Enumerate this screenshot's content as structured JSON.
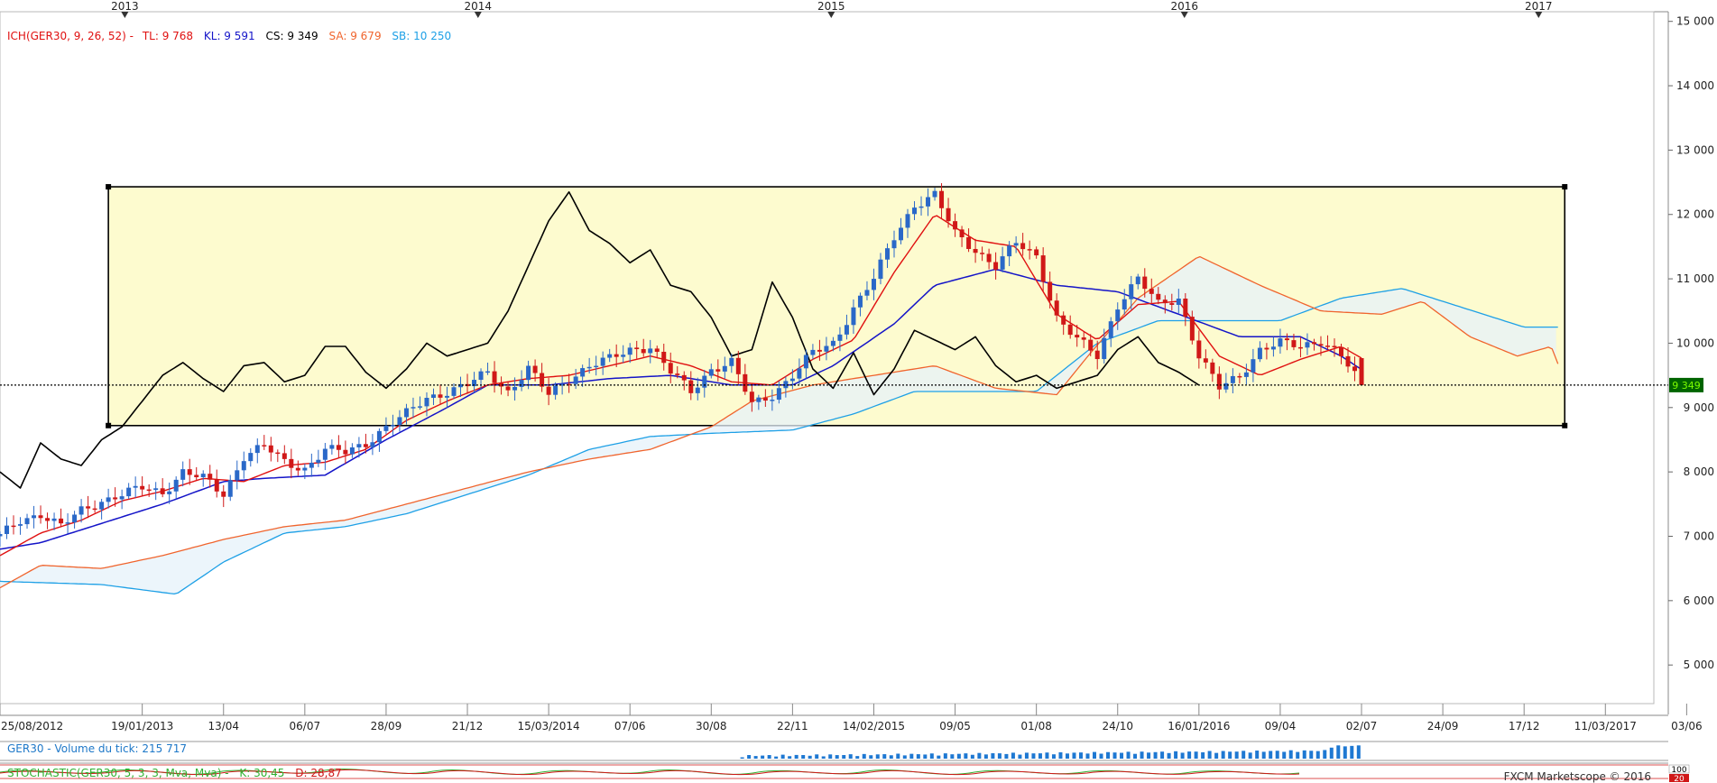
{
  "chart_data": {
    "type": "line",
    "instrument": "GER30",
    "last_price_label": "9 349",
    "y_axis": {
      "ylim": [
        4400,
        15150
      ],
      "tick_labels": [
        "15 000",
        "14 000",
        "13 000",
        "12 000",
        "11 000",
        "10 000",
        "9 000",
        "8 000",
        "7 000",
        "6 000",
        "5 000"
      ],
      "tick_values": [
        15000,
        14000,
        13000,
        12000,
        11000,
        10000,
        9000,
        8000,
        7000,
        6000,
        5000
      ]
    },
    "x_axis": {
      "range": [
        "2012-08-25",
        "2017-05-15"
      ],
      "tick_labels": [
        "25/08/2012",
        "19/01/2013",
        "13/04",
        "06/07",
        "28/09",
        "21/12",
        "15/03/2014",
        "07/06",
        "30/08",
        "22/11",
        "14/02/2015",
        "09/05",
        "01/08",
        "24/10",
        "16/01/2016",
        "09/04",
        "02/07",
        "24/09",
        "17/12",
        "11/03/2017",
        "03/06"
      ],
      "tick_dates": [
        "2012-08-25",
        "2013-01-19",
        "2013-04-13",
        "2013-07-06",
        "2013-09-28",
        "2013-12-21",
        "2014-03-15",
        "2014-06-07",
        "2014-08-30",
        "2014-11-22",
        "2015-02-14",
        "2015-05-09",
        "2015-08-01",
        "2015-10-24",
        "2016-01-16",
        "2016-04-09",
        "2016-07-02",
        "2016-09-24",
        "2016-12-17",
        "2017-03-11",
        "2017-06-03"
      ],
      "year_labels": [
        "2013",
        "2014",
        "2015",
        "2016",
        "2017"
      ],
      "year_dates": [
        "2013-01-01",
        "2014-01-01",
        "2015-01-01",
        "2016-01-01",
        "2017-01-01"
      ]
    },
    "indicator_legend": {
      "title": "ICH(GER30, 9, 26, 52) -",
      "items": [
        {
          "label": "TL: 9 768",
          "color": "#e01010"
        },
        {
          "label": "KL: 9 591",
          "color": "#1414c8"
        },
        {
          "label": "CS: 9 349",
          "color": "#000000"
        },
        {
          "label": "SA: 9 679",
          "color": "#f0642d"
        },
        {
          "label": "SB: 10 250",
          "color": "#1ea0e6"
        }
      ]
    },
    "colors": {
      "up_candle": "#2a68c8",
      "down_candle": "#d01818",
      "tenkan": "#e01010",
      "kijun": "#1414c8",
      "chikou": "#000000",
      "senkou_a": "#f0642d",
      "senkou_b": "#1ea0e6",
      "rectangle_fill": "#fdfbcf",
      "cloud_fill": "#e6f2fa",
      "price_line_bg": "#006400",
      "price_line_text": "#7cfc00"
    },
    "rectangle": {
      "x0": "2012-12-15",
      "x1": "2017-01-28",
      "y_low": 8720,
      "y_high": 12430
    },
    "price": {
      "dates": [
        "2012-08-25",
        "2012-09-15",
        "2012-10-06",
        "2012-10-27",
        "2012-11-17",
        "2012-12-08",
        "2012-12-29",
        "2013-01-19",
        "2013-02-09",
        "2013-03-02",
        "2013-03-23",
        "2013-04-13",
        "2013-05-04",
        "2013-05-25",
        "2013-06-15",
        "2013-07-06",
        "2013-07-27",
        "2013-08-17",
        "2013-09-07",
        "2013-09-28",
        "2013-10-19",
        "2013-11-09",
        "2013-11-30",
        "2013-12-21",
        "2014-01-11",
        "2014-02-01",
        "2014-02-22",
        "2014-03-15",
        "2014-04-05",
        "2014-04-26",
        "2014-05-17",
        "2014-06-07",
        "2014-06-28",
        "2014-07-19",
        "2014-08-09",
        "2014-08-30",
        "2014-09-20",
        "2014-10-11",
        "2014-11-01",
        "2014-11-22",
        "2014-12-13",
        "2015-01-03",
        "2015-01-24",
        "2015-02-14",
        "2015-03-07",
        "2015-03-28",
        "2015-04-18",
        "2015-05-09",
        "2015-05-30",
        "2015-06-20",
        "2015-07-11",
        "2015-08-01",
        "2015-08-22",
        "2015-09-12",
        "2015-10-03",
        "2015-10-24",
        "2015-11-14",
        "2015-12-05",
        "2015-12-26",
        "2016-01-16",
        "2016-02-06",
        "2016-02-27",
        "2016-03-19",
        "2016-04-09",
        "2016-04-30",
        "2016-05-21",
        "2016-06-11",
        "2016-07-02"
      ],
      "close": [
        7000,
        7250,
        7350,
        7150,
        7400,
        7550,
        7650,
        7750,
        7680,
        8000,
        7900,
        7650,
        8250,
        8400,
        8150,
        8050,
        8350,
        8300,
        8450,
        8700,
        8900,
        9150,
        9250,
        9350,
        9550,
        9250,
        9600,
        9200,
        9450,
        9650,
        9750,
        9900,
        9950,
        9550,
        9250,
        9600,
        9700,
        9050,
        9200,
        9500,
        9850,
        10000,
        10550,
        11000,
        11650,
        12150,
        12300,
        11700,
        11450,
        11200,
        11550,
        11350,
        10400,
        10050,
        9800,
        10600,
        11000,
        10600,
        10700,
        9800,
        9300,
        9500,
        9900,
        10000,
        9950,
        10050,
        9800,
        9349
      ]
    },
    "tenkan": {
      "dates": [
        "2012-08-25",
        "2012-10-06",
        "2012-11-17",
        "2012-12-29",
        "2013-02-09",
        "2013-03-23",
        "2013-05-04",
        "2013-06-15",
        "2013-07-27",
        "2013-09-07",
        "2013-10-19",
        "2013-11-30",
        "2014-01-11",
        "2014-02-22",
        "2014-04-05",
        "2014-05-17",
        "2014-06-28",
        "2014-08-09",
        "2014-09-20",
        "2014-11-01",
        "2014-12-13",
        "2015-01-24",
        "2015-03-07",
        "2015-04-18",
        "2015-05-30",
        "2015-07-11",
        "2015-08-22",
        "2015-10-03",
        "2015-11-14",
        "2015-12-26",
        "2016-02-06",
        "2016-03-19",
        "2016-04-30",
        "2016-06-11",
        "2016-07-02"
      ],
      "values": [
        6700,
        7050,
        7250,
        7550,
        7700,
        7900,
        7850,
        8100,
        8150,
        8350,
        8800,
        9100,
        9350,
        9450,
        9500,
        9650,
        9800,
        9650,
        9400,
        9350,
        9750,
        10050,
        11100,
        12000,
        11600,
        11500,
        10450,
        10050,
        10600,
        10650,
        9800,
        9500,
        9750,
        9950,
        9768
      ]
    },
    "kijun": {
      "dates": [
        "2012-08-25",
        "2012-10-06",
        "2012-12-08",
        "2013-02-09",
        "2013-04-13",
        "2013-05-25",
        "2013-07-27",
        "2013-09-28",
        "2013-11-30",
        "2014-01-11",
        "2014-03-15",
        "2014-05-17",
        "2014-07-19",
        "2014-09-20",
        "2014-11-22",
        "2015-01-03",
        "2015-03-07",
        "2015-04-18",
        "2015-06-20",
        "2015-08-22",
        "2015-10-24",
        "2015-12-26",
        "2016-02-27",
        "2016-04-30",
        "2016-06-11",
        "2016-07-02"
      ],
      "values": [
        6800,
        6900,
        7200,
        7500,
        7850,
        7900,
        7950,
        8500,
        9000,
        9350,
        9350,
        9450,
        9500,
        9350,
        9350,
        9650,
        10300,
        10900,
        11150,
        10900,
        10800,
        10450,
        10100,
        10100,
        9800,
        9591
      ]
    },
    "chikou": {
      "dates": [
        "2012-08-25",
        "2012-09-15",
        "2012-10-06",
        "2012-10-27",
        "2012-11-17",
        "2012-12-08",
        "2012-12-29",
        "2013-01-19",
        "2013-02-09",
        "2013-03-02",
        "2013-03-23",
        "2013-04-13",
        "2013-05-04",
        "2013-05-25",
        "2013-06-15",
        "2013-07-06",
        "2013-07-27",
        "2013-08-17",
        "2013-09-07",
        "2013-09-28",
        "2013-10-19",
        "2013-11-09",
        "2013-11-30",
        "2013-12-21",
        "2014-01-11",
        "2014-02-01",
        "2014-02-22",
        "2014-03-15",
        "2014-04-05",
        "2014-04-26",
        "2014-05-17",
        "2014-06-07",
        "2014-06-28",
        "2014-07-19",
        "2014-08-09",
        "2014-08-30",
        "2014-09-20",
        "2014-10-11",
        "2014-11-01",
        "2014-11-22",
        "2014-12-13",
        "2015-01-03",
        "2015-01-24",
        "2015-02-14",
        "2015-03-07",
        "2015-03-28",
        "2015-04-18",
        "2015-05-09",
        "2015-05-30",
        "2015-06-20",
        "2015-07-11",
        "2015-08-01",
        "2015-08-22",
        "2015-09-12",
        "2015-10-03",
        "2015-10-24",
        "2015-11-14",
        "2015-12-05",
        "2015-12-26",
        "2016-01-16"
      ],
      "values": [
        8000,
        7750,
        8450,
        8200,
        8100,
        8500,
        8700,
        9100,
        9500,
        9700,
        9450,
        9250,
        9650,
        9700,
        9400,
        9500,
        9950,
        9950,
        9550,
        9300,
        9600,
        10000,
        9800,
        9900,
        10000,
        10500,
        11200,
        11900,
        12350,
        11750,
        11550,
        11250,
        11450,
        10900,
        10800,
        10400,
        9800,
        9900,
        10950,
        10400,
        9600,
        9300,
        9850,
        9200,
        9600,
        10200,
        10050,
        9900,
        10100,
        9650,
        9400,
        9500,
        9300,
        9400,
        9500,
        9900,
        10100,
        9700,
        9550,
        9349
      ]
    },
    "senkou_a": {
      "dates": [
        "2012-08-25",
        "2012-10-06",
        "2012-12-08",
        "2013-02-09",
        "2013-04-13",
        "2013-06-15",
        "2013-08-17",
        "2013-10-19",
        "2013-12-21",
        "2014-02-22",
        "2014-04-26",
        "2014-06-28",
        "2014-08-30",
        "2014-10-11",
        "2014-12-13",
        "2015-02-14",
        "2015-04-18",
        "2015-06-20",
        "2015-08-22",
        "2015-09-26",
        "2015-11-14",
        "2016-01-16",
        "2016-03-19",
        "2016-05-21",
        "2016-07-23",
        "2016-09-03",
        "2016-10-22",
        "2016-12-10",
        "2017-01-14",
        "2017-01-21"
      ],
      "values": [
        6200,
        6550,
        6500,
        6700,
        6950,
        7150,
        7250,
        7500,
        7750,
        8000,
        8200,
        8350,
        8700,
        9100,
        9350,
        9500,
        9650,
        9300,
        9200,
        9850,
        10700,
        11350,
        10900,
        10500,
        10450,
        10650,
        10100,
        9800,
        9950,
        9679
      ]
    },
    "senkou_b": {
      "dates": [
        "2012-08-25",
        "2012-12-08",
        "2013-02-23",
        "2013-04-13",
        "2013-06-15",
        "2013-08-17",
        "2013-10-19",
        "2013-12-21",
        "2014-02-22",
        "2014-04-26",
        "2014-06-28",
        "2014-08-30",
        "2014-11-22",
        "2015-01-24",
        "2015-03-28",
        "2015-05-30",
        "2015-08-01",
        "2015-10-03",
        "2015-12-05",
        "2016-02-06",
        "2016-04-09",
        "2016-06-11",
        "2016-08-13",
        "2016-10-15",
        "2016-12-17",
        "2017-01-21"
      ],
      "values": [
        6300,
        6250,
        6100,
        6600,
        7050,
        7150,
        7350,
        7650,
        7950,
        8350,
        8550,
        8600,
        8650,
        8900,
        9250,
        9250,
        9250,
        10000,
        10350,
        10350,
        10350,
        10700,
        10850,
        10550,
        10250,
        10250
      ]
    },
    "volume": {
      "label": "GER30 - Volume du tick: 215 717",
      "note": "tick volume bars visible only in late period, rising into July 2016"
    },
    "stochastic": {
      "label": "STOCHASTIC(GER30, 5, 3, 3, Mva, Mva) -",
      "k_label": "K: 30,45",
      "d_label": "D: 28,87",
      "scale_labels": [
        "100",
        "20"
      ]
    },
    "watermark": "FXCM Marketscope © 2016"
  }
}
